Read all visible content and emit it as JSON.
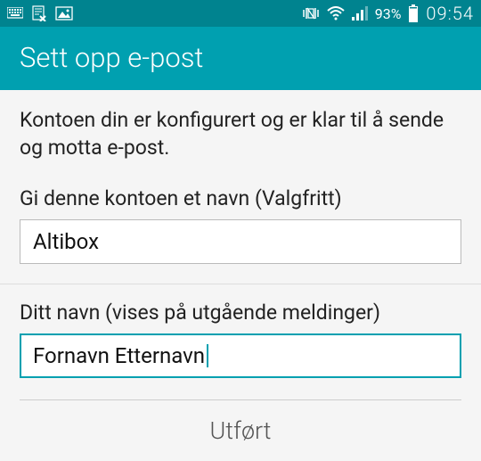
{
  "status": {
    "battery_pct": "93%",
    "time": "09:54"
  },
  "header": {
    "title": "Sett opp e-post"
  },
  "main": {
    "description": "Kontoen din er konfigurert og er klar til å sende og motta e-post.",
    "account_name_label": "Gi denne kontoen et navn (Valgfritt)",
    "account_name_value": "Altibox",
    "your_name_label": "Ditt navn (vises på utgående meldinger)",
    "your_name_value": "Fornavn Etternavn"
  },
  "footer": {
    "done_label": "Utført"
  }
}
